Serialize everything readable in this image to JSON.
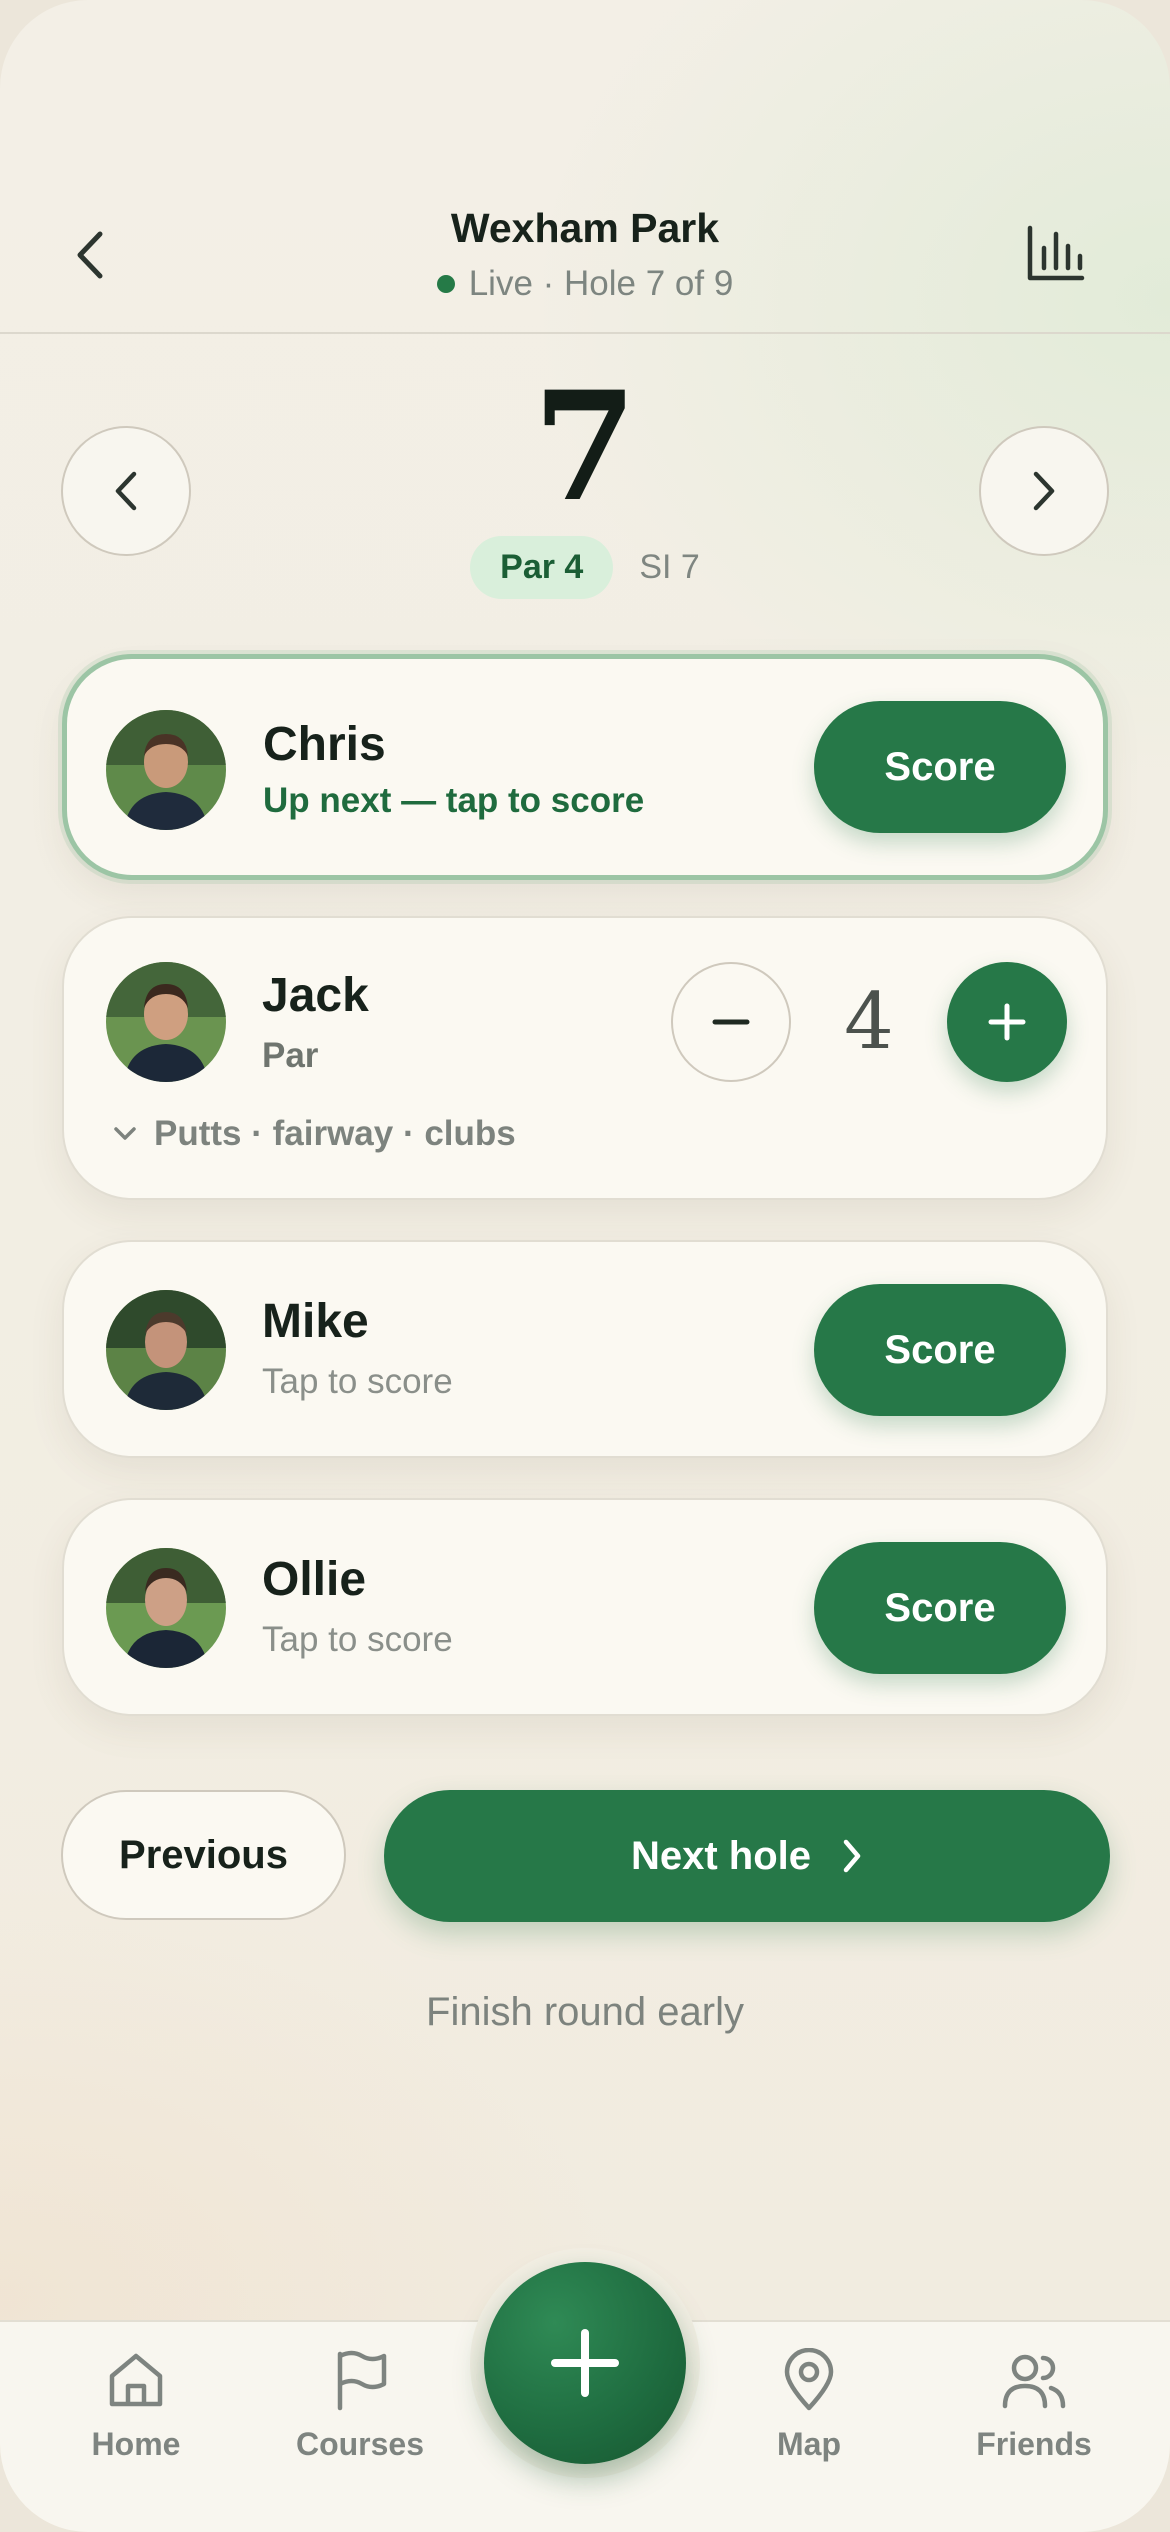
{
  "header": {
    "course_name": "Wexham Park",
    "status": "Live · Hole 7 of 9",
    "live_color": "#257a47"
  },
  "hole": {
    "number": "7",
    "par": "Par 4",
    "stroke_index": "SI 7"
  },
  "players": [
    {
      "name": "Chris",
      "status": "Up next — tap to score",
      "action": "Score",
      "state": "up-next"
    },
    {
      "name": "Jack",
      "status": "Par",
      "strokes": "4",
      "details": "Putts · fairway · clubs",
      "state": "scoring"
    },
    {
      "name": "Mike",
      "status": "Tap to score",
      "action": "Score",
      "state": "pending"
    },
    {
      "name": "Ollie",
      "status": "Tap to score",
      "action": "Score",
      "state": "pending"
    }
  ],
  "actions": {
    "previous": "Previous",
    "next": "Next hole",
    "finish": "Finish round early"
  },
  "tabbar": {
    "tabs": [
      {
        "label": "Home",
        "icon": "home-icon"
      },
      {
        "label": "Courses",
        "icon": "flag-icon"
      },
      {
        "label": "Map",
        "icon": "map-pin-icon"
      },
      {
        "label": "Friends",
        "icon": "friends-icon"
      }
    ],
    "fab_icon": "plus-icon"
  },
  "colors": {
    "accent": "#267848",
    "par_badge_bg": "#d9efdb",
    "background": "#f2eee3"
  }
}
